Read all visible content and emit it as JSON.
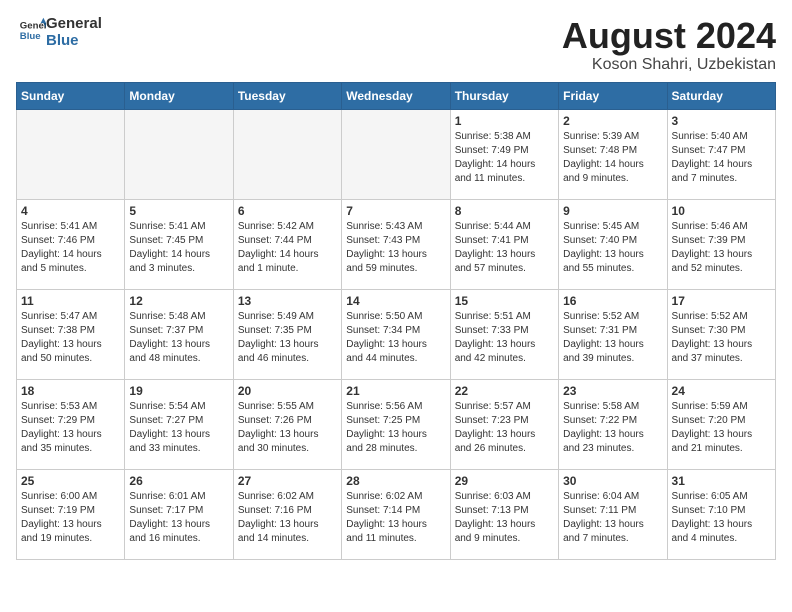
{
  "header": {
    "logo_general": "General",
    "logo_blue": "Blue",
    "month": "August 2024",
    "location": "Koson Shahri, Uzbekistan"
  },
  "weekdays": [
    "Sunday",
    "Monday",
    "Tuesday",
    "Wednesday",
    "Thursday",
    "Friday",
    "Saturday"
  ],
  "weeks": [
    [
      {
        "day": "",
        "sunrise": "",
        "sunset": "",
        "daylight": "",
        "empty": true
      },
      {
        "day": "",
        "sunrise": "",
        "sunset": "",
        "daylight": "",
        "empty": true
      },
      {
        "day": "",
        "sunrise": "",
        "sunset": "",
        "daylight": "",
        "empty": true
      },
      {
        "day": "",
        "sunrise": "",
        "sunset": "",
        "daylight": "",
        "empty": true
      },
      {
        "day": "1",
        "sunrise": "Sunrise: 5:38 AM",
        "sunset": "Sunset: 7:49 PM",
        "daylight": "Daylight: 14 hours and 11 minutes.",
        "empty": false
      },
      {
        "day": "2",
        "sunrise": "Sunrise: 5:39 AM",
        "sunset": "Sunset: 7:48 PM",
        "daylight": "Daylight: 14 hours and 9 minutes.",
        "empty": false
      },
      {
        "day": "3",
        "sunrise": "Sunrise: 5:40 AM",
        "sunset": "Sunset: 7:47 PM",
        "daylight": "Daylight: 14 hours and 7 minutes.",
        "empty": false
      }
    ],
    [
      {
        "day": "4",
        "sunrise": "Sunrise: 5:41 AM",
        "sunset": "Sunset: 7:46 PM",
        "daylight": "Daylight: 14 hours and 5 minutes.",
        "empty": false
      },
      {
        "day": "5",
        "sunrise": "Sunrise: 5:41 AM",
        "sunset": "Sunset: 7:45 PM",
        "daylight": "Daylight: 14 hours and 3 minutes.",
        "empty": false
      },
      {
        "day": "6",
        "sunrise": "Sunrise: 5:42 AM",
        "sunset": "Sunset: 7:44 PM",
        "daylight": "Daylight: 14 hours and 1 minute.",
        "empty": false
      },
      {
        "day": "7",
        "sunrise": "Sunrise: 5:43 AM",
        "sunset": "Sunset: 7:43 PM",
        "daylight": "Daylight: 13 hours and 59 minutes.",
        "empty": false
      },
      {
        "day": "8",
        "sunrise": "Sunrise: 5:44 AM",
        "sunset": "Sunset: 7:41 PM",
        "daylight": "Daylight: 13 hours and 57 minutes.",
        "empty": false
      },
      {
        "day": "9",
        "sunrise": "Sunrise: 5:45 AM",
        "sunset": "Sunset: 7:40 PM",
        "daylight": "Daylight: 13 hours and 55 minutes.",
        "empty": false
      },
      {
        "day": "10",
        "sunrise": "Sunrise: 5:46 AM",
        "sunset": "Sunset: 7:39 PM",
        "daylight": "Daylight: 13 hours and 52 minutes.",
        "empty": false
      }
    ],
    [
      {
        "day": "11",
        "sunrise": "Sunrise: 5:47 AM",
        "sunset": "Sunset: 7:38 PM",
        "daylight": "Daylight: 13 hours and 50 minutes.",
        "empty": false
      },
      {
        "day": "12",
        "sunrise": "Sunrise: 5:48 AM",
        "sunset": "Sunset: 7:37 PM",
        "daylight": "Daylight: 13 hours and 48 minutes.",
        "empty": false
      },
      {
        "day": "13",
        "sunrise": "Sunrise: 5:49 AM",
        "sunset": "Sunset: 7:35 PM",
        "daylight": "Daylight: 13 hours and 46 minutes.",
        "empty": false
      },
      {
        "day": "14",
        "sunrise": "Sunrise: 5:50 AM",
        "sunset": "Sunset: 7:34 PM",
        "daylight": "Daylight: 13 hours and 44 minutes.",
        "empty": false
      },
      {
        "day": "15",
        "sunrise": "Sunrise: 5:51 AM",
        "sunset": "Sunset: 7:33 PM",
        "daylight": "Daylight: 13 hours and 42 minutes.",
        "empty": false
      },
      {
        "day": "16",
        "sunrise": "Sunrise: 5:52 AM",
        "sunset": "Sunset: 7:31 PM",
        "daylight": "Daylight: 13 hours and 39 minutes.",
        "empty": false
      },
      {
        "day": "17",
        "sunrise": "Sunrise: 5:52 AM",
        "sunset": "Sunset: 7:30 PM",
        "daylight": "Daylight: 13 hours and 37 minutes.",
        "empty": false
      }
    ],
    [
      {
        "day": "18",
        "sunrise": "Sunrise: 5:53 AM",
        "sunset": "Sunset: 7:29 PM",
        "daylight": "Daylight: 13 hours and 35 minutes.",
        "empty": false
      },
      {
        "day": "19",
        "sunrise": "Sunrise: 5:54 AM",
        "sunset": "Sunset: 7:27 PM",
        "daylight": "Daylight: 13 hours and 33 minutes.",
        "empty": false
      },
      {
        "day": "20",
        "sunrise": "Sunrise: 5:55 AM",
        "sunset": "Sunset: 7:26 PM",
        "daylight": "Daylight: 13 hours and 30 minutes.",
        "empty": false
      },
      {
        "day": "21",
        "sunrise": "Sunrise: 5:56 AM",
        "sunset": "Sunset: 7:25 PM",
        "daylight": "Daylight: 13 hours and 28 minutes.",
        "empty": false
      },
      {
        "day": "22",
        "sunrise": "Sunrise: 5:57 AM",
        "sunset": "Sunset: 7:23 PM",
        "daylight": "Daylight: 13 hours and 26 minutes.",
        "empty": false
      },
      {
        "day": "23",
        "sunrise": "Sunrise: 5:58 AM",
        "sunset": "Sunset: 7:22 PM",
        "daylight": "Daylight: 13 hours and 23 minutes.",
        "empty": false
      },
      {
        "day": "24",
        "sunrise": "Sunrise: 5:59 AM",
        "sunset": "Sunset: 7:20 PM",
        "daylight": "Daylight: 13 hours and 21 minutes.",
        "empty": false
      }
    ],
    [
      {
        "day": "25",
        "sunrise": "Sunrise: 6:00 AM",
        "sunset": "Sunset: 7:19 PM",
        "daylight": "Daylight: 13 hours and 19 minutes.",
        "empty": false
      },
      {
        "day": "26",
        "sunrise": "Sunrise: 6:01 AM",
        "sunset": "Sunset: 7:17 PM",
        "daylight": "Daylight: 13 hours and 16 minutes.",
        "empty": false
      },
      {
        "day": "27",
        "sunrise": "Sunrise: 6:02 AM",
        "sunset": "Sunset: 7:16 PM",
        "daylight": "Daylight: 13 hours and 14 minutes.",
        "empty": false
      },
      {
        "day": "28",
        "sunrise": "Sunrise: 6:02 AM",
        "sunset": "Sunset: 7:14 PM",
        "daylight": "Daylight: 13 hours and 11 minutes.",
        "empty": false
      },
      {
        "day": "29",
        "sunrise": "Sunrise: 6:03 AM",
        "sunset": "Sunset: 7:13 PM",
        "daylight": "Daylight: 13 hours and 9 minutes.",
        "empty": false
      },
      {
        "day": "30",
        "sunrise": "Sunrise: 6:04 AM",
        "sunset": "Sunset: 7:11 PM",
        "daylight": "Daylight: 13 hours and 7 minutes.",
        "empty": false
      },
      {
        "day": "31",
        "sunrise": "Sunrise: 6:05 AM",
        "sunset": "Sunset: 7:10 PM",
        "daylight": "Daylight: 13 hours and 4 minutes.",
        "empty": false
      }
    ]
  ]
}
